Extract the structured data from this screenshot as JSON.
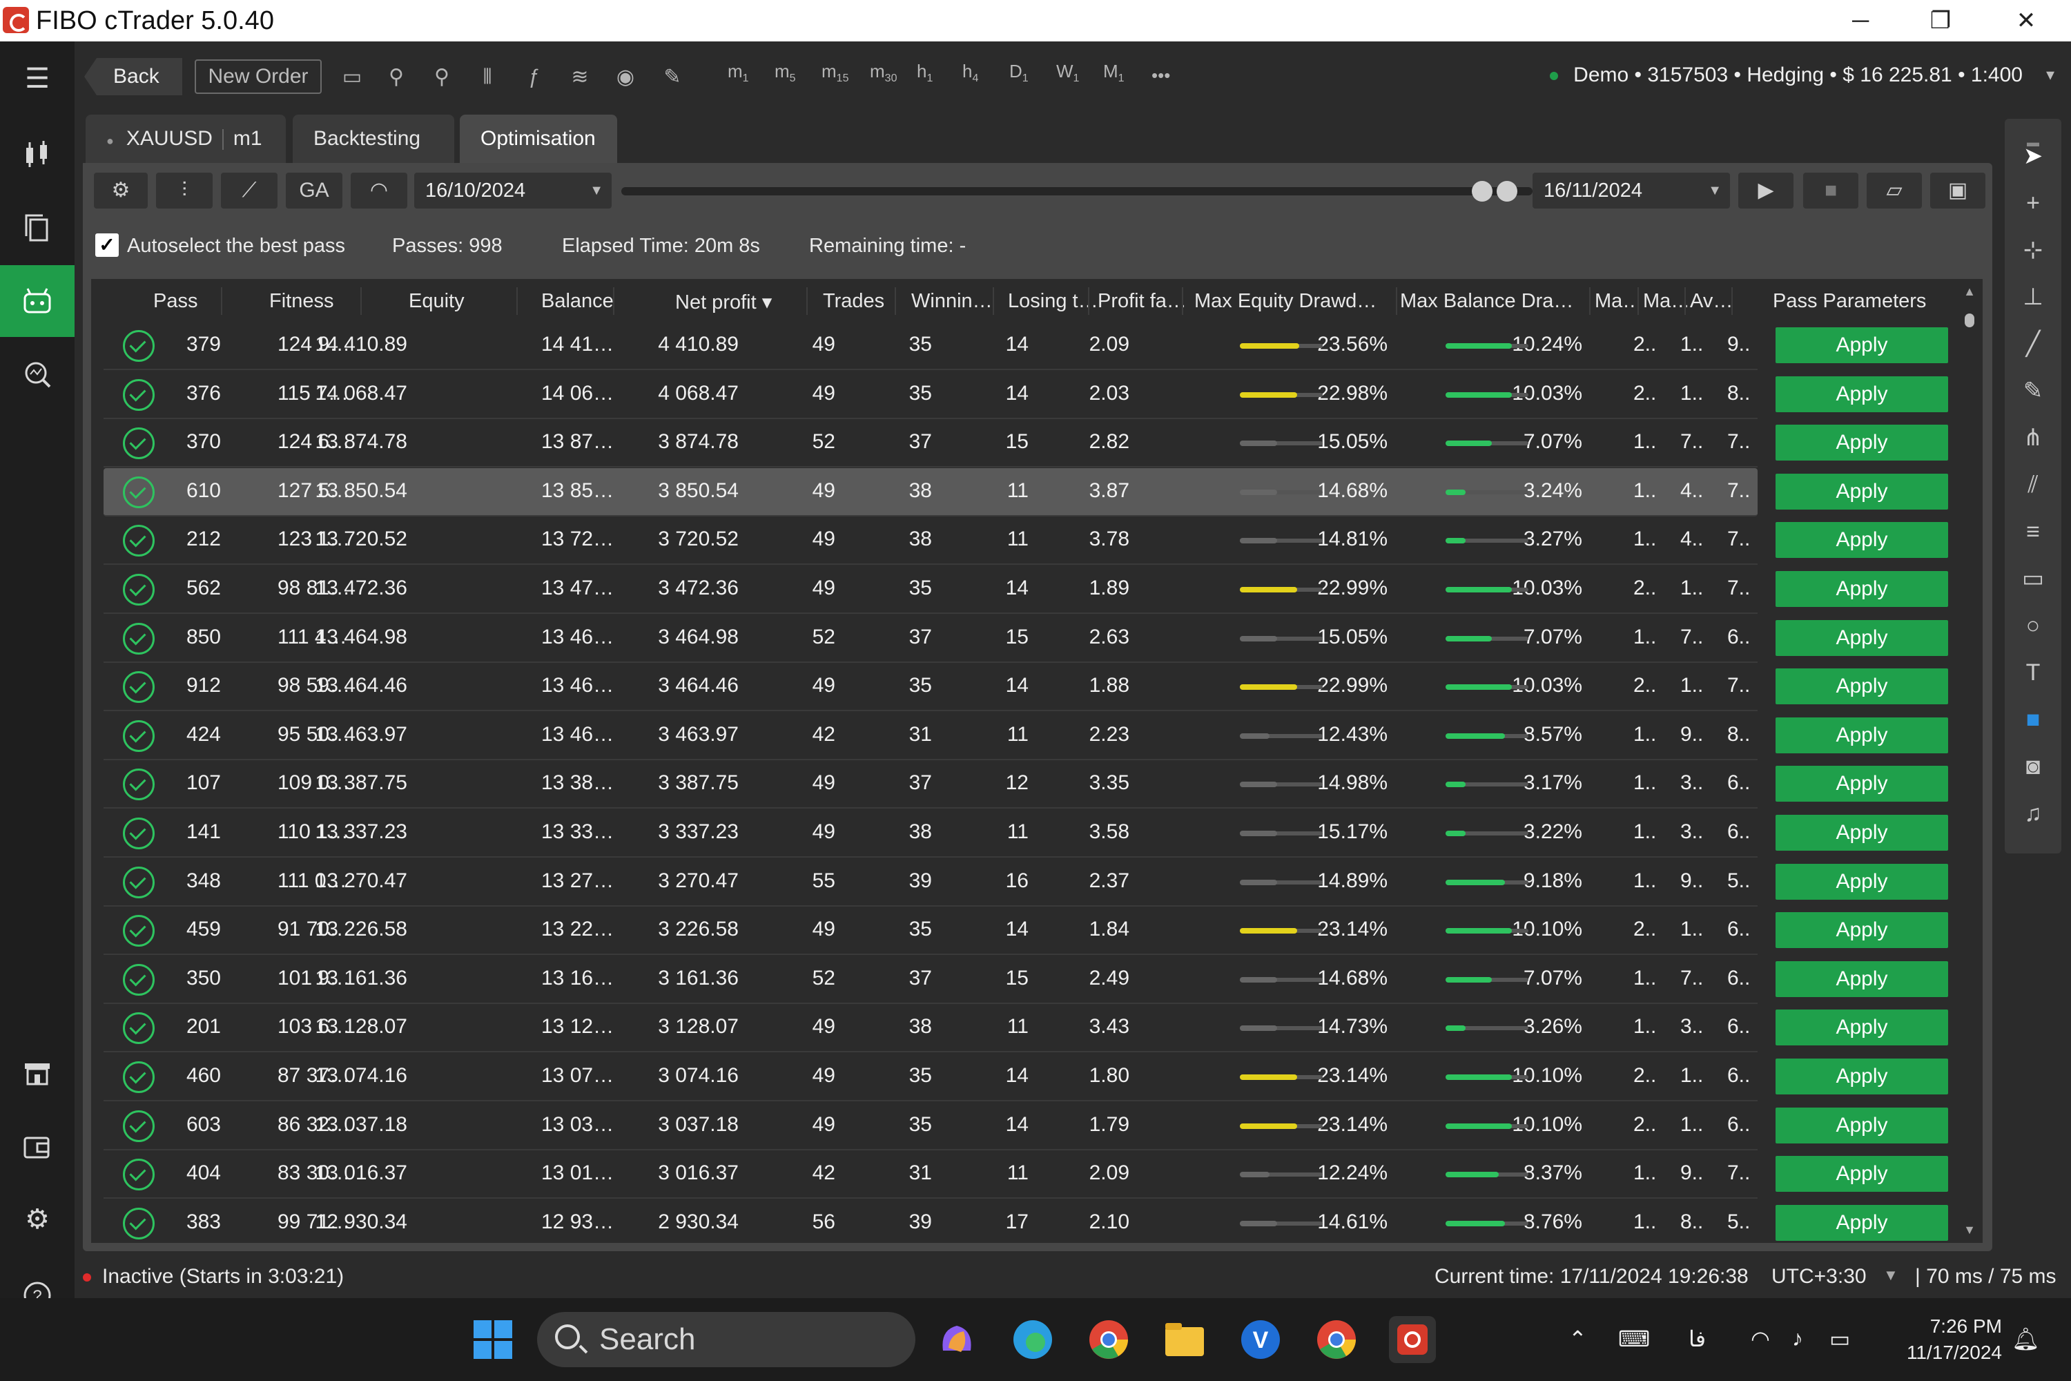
{
  "window": {
    "title": "FIBO cTrader 5.0.40",
    "minimize": "─",
    "maximize": "❐",
    "close": "✕"
  },
  "toolbar": {
    "back_label": "Back",
    "new_order_label": "New Order",
    "timeframes": [
      {
        "main": "m",
        "sub": "1"
      },
      {
        "main": "m",
        "sub": "5"
      },
      {
        "main": "m",
        "sub": "15"
      },
      {
        "main": "m",
        "sub": "30"
      },
      {
        "main": "h",
        "sub": "1"
      },
      {
        "main": "h",
        "sub": "4"
      },
      {
        "main": "D",
        "sub": "1"
      },
      {
        "main": "W",
        "sub": "1"
      },
      {
        "main": "M",
        "sub": "1"
      }
    ],
    "more": "•••",
    "account": "Demo • 3157503 • Hedging • $ 16 225.81 • 1:400"
  },
  "tabs": [
    {
      "label": "XAUUSD",
      "extra": "m1"
    },
    {
      "label": "Backtesting"
    },
    {
      "label": "Optimisation"
    }
  ],
  "controls": {
    "ga_label": "GA",
    "start_date": "16/10/2024",
    "end_date": "16/11/2024"
  },
  "info": {
    "autoselect_label": "Autoselect the best pass",
    "passes": "Passes:  998",
    "elapsed": "Elapsed Time:  20m 8s",
    "remaining": "Remaining time:  -"
  },
  "columns": [
    "Pass",
    "Fitness",
    "Equity",
    "Balance",
    "Net profit ▾",
    "Trades",
    "Winnin…",
    "Losing t…",
    "Profit fa…",
    "Max Equity Drawd…",
    "Max Balance Dra…",
    "Ma…",
    "Ma…",
    "Av…",
    "Pass Parameters"
  ],
  "apply_label": "Apply",
  "rows": [
    {
      "pass": "379",
      "fitness": "124 9…",
      "equity": "14 410.89",
      "balance": "14 41…",
      "net": "4 410.89",
      "trades": "49",
      "win": "35",
      "lose": "14",
      "pf": "2.09",
      "med": "23.56%",
      "med_fill": 0.24,
      "mbd": "10.24%",
      "mbd_fill": 0.1,
      "c1": "2..",
      "c2": "1..",
      "c3": "9.."
    },
    {
      "pass": "376",
      "fitness": "115 7…",
      "equity": "14 068.47",
      "balance": "14 06…",
      "net": "4 068.47",
      "trades": "49",
      "win": "35",
      "lose": "14",
      "pf": "2.03",
      "med": "22.98%",
      "med_fill": 0.23,
      "mbd": "10.03%",
      "mbd_fill": 0.1,
      "c1": "2..",
      "c2": "1..",
      "c3": "8.."
    },
    {
      "pass": "370",
      "fitness": "124 6…",
      "equity": "13 874.78",
      "balance": "13 87…",
      "net": "3 874.78",
      "trades": "52",
      "win": "37",
      "lose": "15",
      "pf": "2.82",
      "med": "15.05%",
      "med_fill": 0.15,
      "mbd": "7.07%",
      "mbd_fill": 0.07,
      "c1": "1..",
      "c2": "7..",
      "c3": "7.."
    },
    {
      "pass": "610",
      "fitness": "127 5…",
      "equity": "13 850.54",
      "balance": "13 85…",
      "net": "3 850.54",
      "trades": "49",
      "win": "38",
      "lose": "11",
      "pf": "3.87",
      "med": "14.68%",
      "med_fill": 0.15,
      "mbd": "3.24%",
      "mbd_fill": 0.03,
      "c1": "1..",
      "c2": "4..",
      "c3": "7.."
    },
    {
      "pass": "212",
      "fitness": "123 1…",
      "equity": "13 720.52",
      "balance": "13 72…",
      "net": "3 720.52",
      "trades": "49",
      "win": "38",
      "lose": "11",
      "pf": "3.78",
      "med": "14.81%",
      "med_fill": 0.15,
      "mbd": "3.27%",
      "mbd_fill": 0.03,
      "c1": "1..",
      "c2": "4..",
      "c3": "7.."
    },
    {
      "pass": "562",
      "fitness": "98 81…",
      "equity": "13 472.36",
      "balance": "13 47…",
      "net": "3 472.36",
      "trades": "49",
      "win": "35",
      "lose": "14",
      "pf": "1.89",
      "med": "22.99%",
      "med_fill": 0.23,
      "mbd": "10.03%",
      "mbd_fill": 0.1,
      "c1": "2..",
      "c2": "1..",
      "c3": "7.."
    },
    {
      "pass": "850",
      "fitness": "111 4…",
      "equity": "13 464.98",
      "balance": "13 46…",
      "net": "3 464.98",
      "trades": "52",
      "win": "37",
      "lose": "15",
      "pf": "2.63",
      "med": "15.05%",
      "med_fill": 0.15,
      "mbd": "7.07%",
      "mbd_fill": 0.07,
      "c1": "1..",
      "c2": "7..",
      "c3": "6.."
    },
    {
      "pass": "912",
      "fitness": "98 59…",
      "equity": "13 464.46",
      "balance": "13 46…",
      "net": "3 464.46",
      "trades": "49",
      "win": "35",
      "lose": "14",
      "pf": "1.88",
      "med": "22.99%",
      "med_fill": 0.23,
      "mbd": "10.03%",
      "mbd_fill": 0.1,
      "c1": "2..",
      "c2": "1..",
      "c3": "7.."
    },
    {
      "pass": "424",
      "fitness": "95 50…",
      "equity": "13 463.97",
      "balance": "13 46…",
      "net": "3 463.97",
      "trades": "42",
      "win": "31",
      "lose": "11",
      "pf": "2.23",
      "med": "12.43%",
      "med_fill": 0.12,
      "mbd": "8.57%",
      "mbd_fill": 0.09,
      "c1": "1..",
      "c2": "9..",
      "c3": "8.."
    },
    {
      "pass": "107",
      "fitness": "109 0…",
      "equity": "13 387.75",
      "balance": "13 38…",
      "net": "3 387.75",
      "trades": "49",
      "win": "37",
      "lose": "12",
      "pf": "3.35",
      "med": "14.98%",
      "med_fill": 0.15,
      "mbd": "3.17%",
      "mbd_fill": 0.03,
      "c1": "1..",
      "c2": "3..",
      "c3": "6.."
    },
    {
      "pass": "141",
      "fitness": "110 1…",
      "equity": "13 337.23",
      "balance": "13 33…",
      "net": "3 337.23",
      "trades": "49",
      "win": "38",
      "lose": "11",
      "pf": "3.58",
      "med": "15.17%",
      "med_fill": 0.15,
      "mbd": "3.22%",
      "mbd_fill": 0.03,
      "c1": "1..",
      "c2": "3..",
      "c3": "6.."
    },
    {
      "pass": "348",
      "fitness": "111 0…",
      "equity": "13 270.47",
      "balance": "13 27…",
      "net": "3 270.47",
      "trades": "55",
      "win": "39",
      "lose": "16",
      "pf": "2.37",
      "med": "14.89%",
      "med_fill": 0.15,
      "mbd": "9.18%",
      "mbd_fill": 0.09,
      "c1": "1..",
      "c2": "9..",
      "c3": "5.."
    },
    {
      "pass": "459",
      "fitness": "91 70…",
      "equity": "13 226.58",
      "balance": "13 22…",
      "net": "3 226.58",
      "trades": "49",
      "win": "35",
      "lose": "14",
      "pf": "1.84",
      "med": "23.14%",
      "med_fill": 0.23,
      "mbd": "10.10%",
      "mbd_fill": 0.1,
      "c1": "2..",
      "c2": "1..",
      "c3": "6.."
    },
    {
      "pass": "350",
      "fitness": "101 9…",
      "equity": "13 161.36",
      "balance": "13 16…",
      "net": "3 161.36",
      "trades": "52",
      "win": "37",
      "lose": "15",
      "pf": "2.49",
      "med": "14.68%",
      "med_fill": 0.15,
      "mbd": "7.07%",
      "mbd_fill": 0.07,
      "c1": "1..",
      "c2": "7..",
      "c3": "6.."
    },
    {
      "pass": "201",
      "fitness": "103 6…",
      "equity": "13 128.07",
      "balance": "13 12…",
      "net": "3 128.07",
      "trades": "49",
      "win": "38",
      "lose": "11",
      "pf": "3.43",
      "med": "14.73%",
      "med_fill": 0.15,
      "mbd": "3.26%",
      "mbd_fill": 0.03,
      "c1": "1..",
      "c2": "3..",
      "c3": "6.."
    },
    {
      "pass": "460",
      "fitness": "87 37…",
      "equity": "13 074.16",
      "balance": "13 07…",
      "net": "3 074.16",
      "trades": "49",
      "win": "35",
      "lose": "14",
      "pf": "1.80",
      "med": "23.14%",
      "med_fill": 0.23,
      "mbd": "10.10%",
      "mbd_fill": 0.1,
      "c1": "2..",
      "c2": "1..",
      "c3": "6.."
    },
    {
      "pass": "603",
      "fitness": "86 32…",
      "equity": "13 037.18",
      "balance": "13 03…",
      "net": "3 037.18",
      "trades": "49",
      "win": "35",
      "lose": "14",
      "pf": "1.79",
      "med": "23.14%",
      "med_fill": 0.23,
      "mbd": "10.10%",
      "mbd_fill": 0.1,
      "c1": "2..",
      "c2": "1..",
      "c3": "6.."
    },
    {
      "pass": "404",
      "fitness": "83 30…",
      "equity": "13 016.37",
      "balance": "13 01…",
      "net": "3 016.37",
      "trades": "42",
      "win": "31",
      "lose": "11",
      "pf": "2.09",
      "med": "12.24%",
      "med_fill": 0.12,
      "mbd": "8.37%",
      "mbd_fill": 0.08,
      "c1": "1..",
      "c2": "9..",
      "c3": "7.."
    },
    {
      "pass": "383",
      "fitness": "99 71…",
      "equity": "12 930.34",
      "balance": "12 93…",
      "net": "2 930.34",
      "trades": "56",
      "win": "39",
      "lose": "17",
      "pf": "2.10",
      "med": "14.61%",
      "med_fill": 0.15,
      "mbd": "8.76%",
      "mbd_fill": 0.09,
      "c1": "1..",
      "c2": "8..",
      "c3": "5.."
    }
  ],
  "selected_row": 3,
  "status": {
    "inactive": "Inactive (Starts in 3:03:21)",
    "current_time": "Current time: 17/11/2024 19:26:38",
    "timezone": "UTC+3:30",
    "latency": "|  70 ms / 75 ms"
  },
  "taskbar": {
    "search_placeholder": "Search",
    "lang": "فا",
    "time": "7:26 PM",
    "date": "11/17/2024"
  },
  "colors": {
    "accent_green": "#1fa04b",
    "bar_yellow": "#e3d21b",
    "bar_green": "#2ec35f"
  }
}
